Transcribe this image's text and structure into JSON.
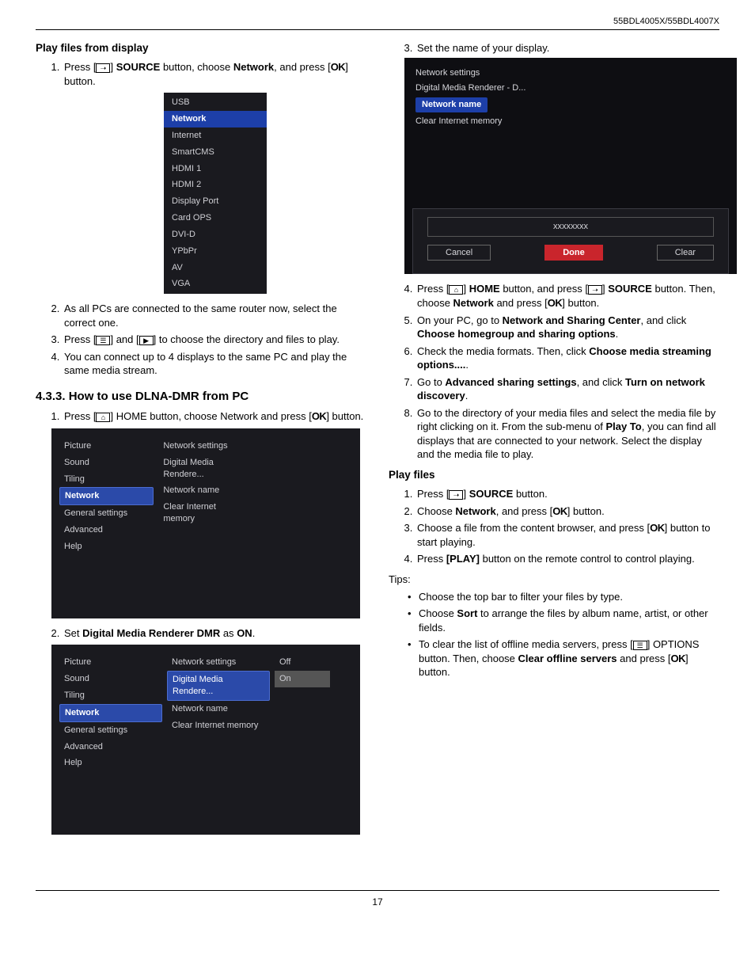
{
  "header": {
    "model": "55BDL4005X/55BDL4007X"
  },
  "footer": {
    "page": "17"
  },
  "left": {
    "h1": "Play files from display",
    "s1": {
      "pre": "Press [",
      "mid": "] ",
      "src": "SOURCE",
      "after": " button, choose ",
      "net": "Network",
      "after2": ", and press [",
      "ok": "OK",
      "end": "] button."
    },
    "src_menu": [
      "USB",
      "Network",
      "Internet",
      "SmartCMS",
      "HDMI 1",
      "HDMI 2",
      "Display Port",
      "Card OPS",
      "DVI-D",
      "YPbPr",
      "AV",
      "VGA"
    ],
    "s2": "As all PCs are connected to the same router now, select the correct one.",
    "s3": {
      "a": "Press [",
      "b": "] and [",
      "c": "] to choose the directory and files to play."
    },
    "s4": "You can connect up to 4 displays to the same PC and play the same media stream.",
    "h2": "4.3.3.  How to use DLNA-DMR from PC",
    "d1": {
      "a": "Press [",
      "b": "]  HOME button, choose Network and press [",
      "ok": "OK",
      "c": "] button."
    },
    "settings_left": [
      "Picture",
      "Sound",
      "Tiling",
      "Network",
      "General settings",
      "Advanced",
      "Help"
    ],
    "settings_mid": [
      "Network settings",
      "Digital Media Rendere...",
      "Network name",
      "Clear Internet memory"
    ],
    "settings_right_offon": [
      "Off",
      "On"
    ],
    "d2": {
      "a": "Set ",
      "b": "Digital Media Renderer DMR",
      "c": " as ",
      "d": "ON",
      "e": "."
    }
  },
  "right": {
    "r3": "Set the name of your display.",
    "netbox_items": [
      "Network settings",
      "Digital Media Renderer - D...",
      "Network name",
      "Clear Internet memory"
    ],
    "input_placeholder": "xxxxxxxx",
    "btns": {
      "cancel": "Cancel",
      "done": "Done",
      "clear": "Clear"
    },
    "r4": {
      "a": "Press  [",
      "home": "HOME",
      "b": " button, and press [",
      "src": "SOURCE",
      "c": " button. Then, choose ",
      "net": "Network",
      "d": " and press [",
      "ok": "OK",
      "e": "] button."
    },
    "r5": {
      "a": "On your PC, go to ",
      "b": "Network and Sharing Center",
      "c": ", and click ",
      "d": "Choose homegroup and sharing options",
      "e": "."
    },
    "r6": {
      "a": "Check the media formats. Then, click ",
      "b": "Choose media streaming options....",
      "c": "."
    },
    "r7": {
      "a": "Go to ",
      "b": "Advanced sharing settings",
      "c": ", and click ",
      "d": "Turn on network discovery",
      "e": "."
    },
    "r8": {
      "a": "Go to the directory of your media files and select the media file by right clicking on it. From the sub-menu of ",
      "b": "Play To",
      "c": ", you can find all displays that are connected to your network. Select the display and the media file to play."
    },
    "h_play": "Play files",
    "p1": {
      "a": "Press [",
      "b": "] ",
      "src": "SOURCE",
      "c": " button."
    },
    "p2": {
      "a": "Choose ",
      "net": "Network",
      "b": ", and press [",
      "ok": "OK",
      "c": "] button."
    },
    "p3": {
      "a": "Choose a file from the content browser, and press [",
      "ok": "OK",
      "b": "] button to start playing."
    },
    "p4": {
      "a": "Press ",
      "b": "[PLAY]",
      "c": " button on the remote control to control playing."
    },
    "tips_label": "Tips:",
    "t1": "Choose the top bar to filter your files by type.",
    "t2": {
      "a": "Choose ",
      "b": "Sort",
      "c": " to arrange the files by album name, artist, or other fields."
    },
    "t3": {
      "a": "To clear the list of offline media servers, press [",
      "b": "] OPTIONS button. Then, choose ",
      "c": "Clear offline servers",
      "d": " and press [",
      "ok": "OK",
      "e": "] button."
    }
  }
}
